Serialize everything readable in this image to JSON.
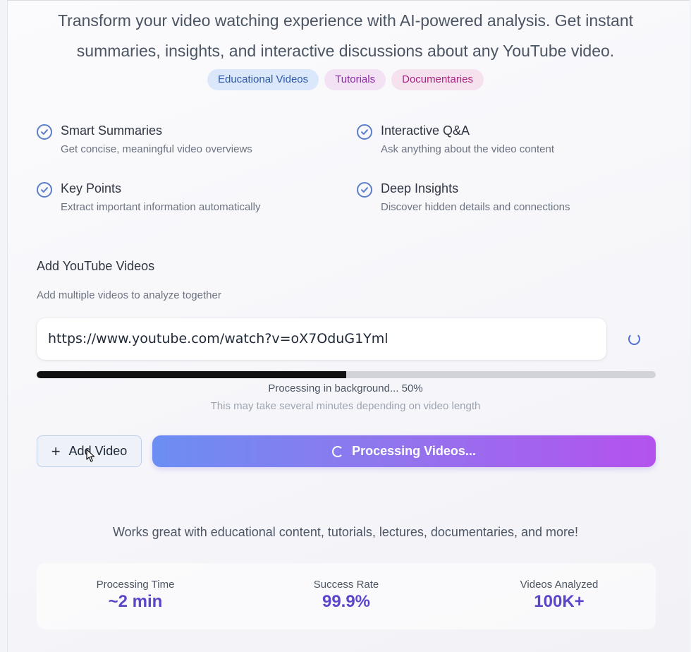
{
  "hero": {
    "line1": "Transform your video watching experience with AI-powered analysis. Get instant",
    "line2": "summaries, insights, and interactive discussions about any YouTube video."
  },
  "tags": [
    "Educational Videos",
    "Tutorials",
    "Documentaries"
  ],
  "features": [
    {
      "title": "Smart Summaries",
      "desc": "Get concise, meaningful video overviews",
      "icon": "check-circle-icon"
    },
    {
      "title": "Interactive Q&A",
      "desc": "Ask anything about the video content",
      "icon": "check-circle-icon"
    },
    {
      "title": "Key Points",
      "desc": "Extract important information automatically",
      "icon": "check-circle-icon"
    },
    {
      "title": "Deep Insights",
      "desc": "Discover hidden details and connections",
      "icon": "check-circle-icon"
    }
  ],
  "videos_section": {
    "title": "Add YouTube Videos",
    "subtitle": "Add multiple videos to analyze together",
    "url_value": "https://www.youtube.com/watch?v=oX7OduG1Yml",
    "progress_percent": 50,
    "progress_text": "Processing in background... 50%",
    "progress_note": "This may take several minutes depending on video length",
    "add_button": "Add Video",
    "process_button": "Processing Videos..."
  },
  "works_text": "Works great with educational content, tutorials, lectures, documentaries, and more!",
  "stats": [
    {
      "label": "Processing Time",
      "value": "~2 min"
    },
    {
      "label": "Success Rate",
      "value": "99.9%"
    },
    {
      "label": "Videos Analyzed",
      "value": "100K+"
    }
  ],
  "colors": {
    "accent_purple": "#5a46c8",
    "button_gradient_start": "#6b8ef3",
    "button_gradient_end": "#b452ee",
    "check_icon": "#5b7ec9"
  }
}
